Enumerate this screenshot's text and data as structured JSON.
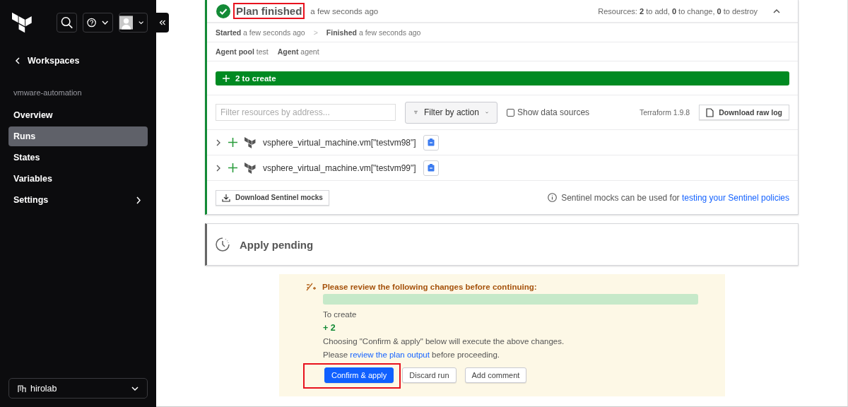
{
  "sidebar": {
    "back_link": "Workspaces",
    "workspace": "vmware-automation",
    "items": [
      {
        "label": "Overview",
        "selected": false,
        "has_submenu": false
      },
      {
        "label": "Runs",
        "selected": true,
        "has_submenu": false
      },
      {
        "label": "States",
        "selected": false,
        "has_submenu": false
      },
      {
        "label": "Variables",
        "selected": false,
        "has_submenu": false
      },
      {
        "label": "Settings",
        "selected": false,
        "has_submenu": true
      }
    ],
    "organization": "hirolab"
  },
  "plan": {
    "title": "Plan finished",
    "title_highlighted": true,
    "time": "a few seconds ago",
    "resources": {
      "label": "Resources:",
      "add": "2",
      "add_text": "to add,",
      "change": "0",
      "change_text": "to change,",
      "destroy": "0",
      "destroy_text": "to destroy"
    },
    "started_label": "Started",
    "started": "a few seconds ago",
    "separator": ">",
    "finished_label": "Finished",
    "finished": "a few seconds ago",
    "agent_pool_label": "Agent pool",
    "agent_pool": "test",
    "agent_label": "Agent",
    "agent": "agent",
    "summary_bar": "2 to create",
    "filter": {
      "placeholder": "Filter resources by address...",
      "action_button": "Filter by action",
      "show_data_sources": {
        "label": "Show data sources",
        "checked": false
      },
      "version": "Terraform 1.9.8",
      "download_log": "Download raw log"
    },
    "resources_list": [
      {
        "address": "vsphere_virtual_machine.vm[\"testvm98\"]",
        "expanded": false
      },
      {
        "address": "vsphere_virtual_machine.vm[\"testvm99\"]",
        "expanded": false
      }
    ],
    "sentinel_button": "Download Sentinel mocks",
    "sentinel_note": "Sentinel mocks can be used for",
    "sentinel_link": "testing your Sentinel policies"
  },
  "apply": {
    "title": "Apply pending"
  },
  "review": {
    "heading": "Please review the following changes before continuing:",
    "to_create_label": "To create",
    "to_create": "+ 2",
    "sentence": "Choosing \"Confirm & apply\" below will execute the above changes.",
    "please": "Please",
    "link": "review the plan output",
    "after": "before proceeding.",
    "buttons": [
      {
        "label": "Confirm & apply",
        "kind": "primary",
        "highlighted": true
      },
      {
        "label": "Discard run",
        "kind": "secondary",
        "highlighted": false
      },
      {
        "label": "Add comment",
        "kind": "secondary",
        "highlighted": false
      }
    ]
  }
}
